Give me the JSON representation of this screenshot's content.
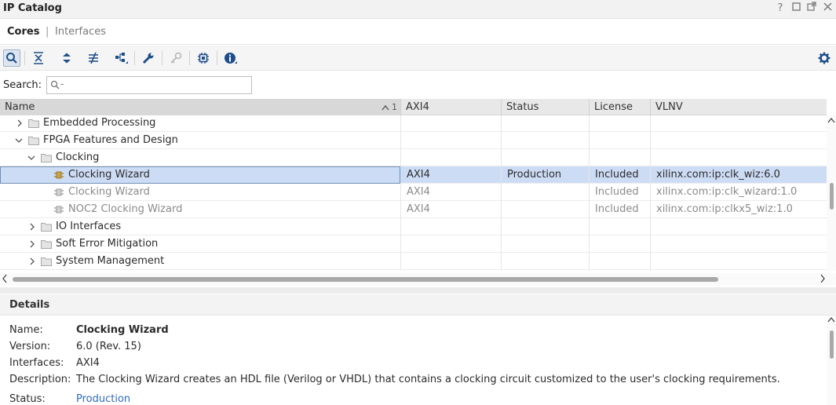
{
  "window": {
    "title": "IP Catalog",
    "controls": [
      "?",
      "restore",
      "float",
      "close"
    ]
  },
  "tabs": [
    {
      "label": "Cores",
      "active": true
    },
    {
      "label": "Interfaces",
      "active": false
    }
  ],
  "toolbar": {
    "buttons": [
      "search-icon",
      "collapse-all-icon",
      "expand-all-icon",
      "filter-icon",
      "hierarchy-icon",
      "wrench-icon",
      "key-icon",
      "chip-icon",
      "info-icon"
    ],
    "settings": "gear-icon"
  },
  "search": {
    "label": "Search:",
    "placeholder": "Q-",
    "value": ""
  },
  "grid": {
    "columns": [
      "Name",
      "AXI4",
      "Status",
      "License",
      "VLNV"
    ],
    "sort_indicator": "1",
    "rows": [
      {
        "name": "Embedded Processing",
        "type": "folder",
        "level": 1,
        "expanded": false,
        "axi4": "",
        "status": "",
        "license": "",
        "vlnv": ""
      },
      {
        "name": "FPGA Features and Design",
        "type": "folder",
        "level": 1,
        "expanded": true,
        "axi4": "",
        "status": "",
        "license": "",
        "vlnv": ""
      },
      {
        "name": "Clocking",
        "type": "folder",
        "level": 2,
        "expanded": true,
        "axi4": "",
        "status": "",
        "license": "",
        "vlnv": ""
      },
      {
        "name": "Clocking Wizard",
        "type": "ip",
        "level": 3,
        "selected": true,
        "disabled": false,
        "axi4": "AXI4",
        "status": "Production",
        "license": "Included",
        "vlnv": "xilinx.com:ip:clk_wiz:6.0"
      },
      {
        "name": "Clocking Wizard",
        "type": "ip",
        "level": 3,
        "selected": false,
        "disabled": true,
        "axi4": "AXI4",
        "status": "",
        "license": "Included",
        "vlnv": "xilinx.com:ip:clk_wizard:1.0"
      },
      {
        "name": "NOC2 Clocking Wizard",
        "type": "ip",
        "level": 3,
        "selected": false,
        "disabled": true,
        "axi4": "AXI4",
        "status": "",
        "license": "Included",
        "vlnv": "xilinx.com:ip:clkx5_wiz:1.0"
      },
      {
        "name": "IO Interfaces",
        "type": "folder",
        "level": 2,
        "expanded": false,
        "axi4": "",
        "status": "",
        "license": "",
        "vlnv": ""
      },
      {
        "name": "Soft Error Mitigation",
        "type": "folder",
        "level": 2,
        "expanded": false,
        "axi4": "",
        "status": "",
        "license": "",
        "vlnv": ""
      },
      {
        "name": "System Management",
        "type": "folder",
        "level": 2,
        "expanded": false,
        "axi4": "",
        "status": "",
        "license": "",
        "vlnv": ""
      }
    ]
  },
  "details": {
    "title": "Details",
    "fields": [
      {
        "key": "Name:",
        "value": "Clocking Wizard",
        "style": "bold"
      },
      {
        "key": "Version:",
        "value": "6.0 (Rev. 15)",
        "style": "normal"
      },
      {
        "key": "Interfaces:",
        "value": "AXI4",
        "style": "normal"
      },
      {
        "key": "Description:",
        "value": "The Clocking Wizard creates an HDL file (Verilog or VHDL) that contains a clocking circuit customized to the user's clocking requirements.",
        "style": "normal"
      },
      {
        "key": "Status:",
        "value": "Production",
        "style": "link"
      }
    ]
  },
  "colors": {
    "selection": "#cddcf5",
    "link": "#2f6bc0",
    "icon_blue": "#1e4f8a",
    "ip_icon": "#c8a24a"
  }
}
